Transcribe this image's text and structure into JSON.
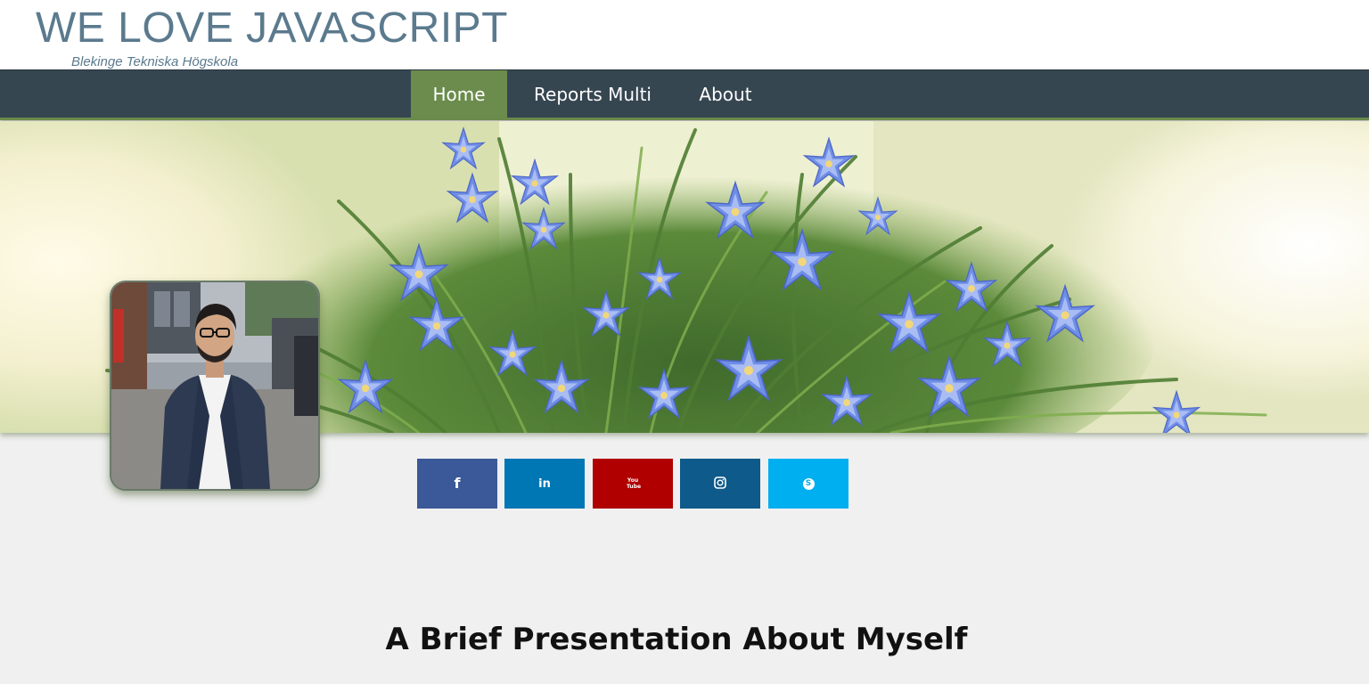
{
  "header": {
    "title": "WE LOVE JAVASCRIPT",
    "subtitle": "Blekinge Tekniska Högskola"
  },
  "nav": {
    "items": [
      {
        "label": "Home",
        "active": true
      },
      {
        "label": "Reports Multi",
        "active": false
      },
      {
        "label": "About",
        "active": false
      }
    ]
  },
  "social": [
    {
      "name": "facebook-icon",
      "glyph": "f",
      "color": "#3b5998"
    },
    {
      "name": "linkedin-icon",
      "glyph": "in",
      "color": "#0077b5"
    },
    {
      "name": "youtube-icon",
      "glyph": "You Tube",
      "color": "#b00000"
    },
    {
      "name": "instagram-icon",
      "glyph": "",
      "color": "#0e5a8a"
    },
    {
      "name": "skype-icon",
      "glyph": "S",
      "color": "#00aff0"
    }
  ],
  "main": {
    "heading": "A Brief Presentation About Myself"
  },
  "colors": {
    "nav_bg": "#364651",
    "nav_active": "#6b8c4c",
    "title": "#5b7a8e",
    "page_bg": "#f0f0f0"
  }
}
